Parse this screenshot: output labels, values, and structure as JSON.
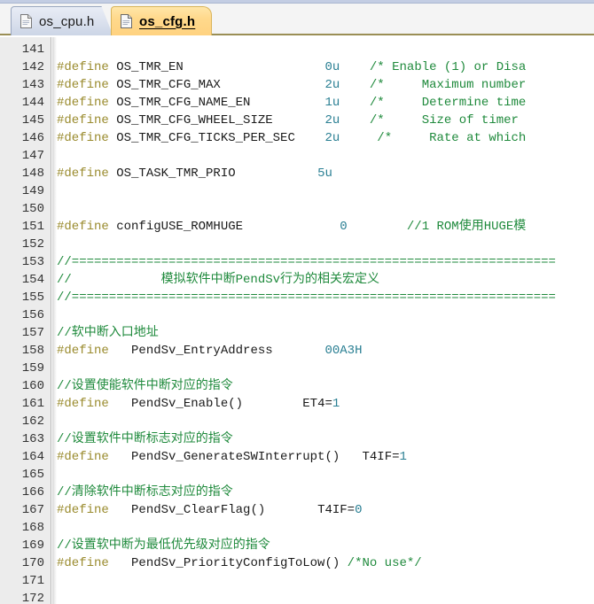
{
  "window": {
    "title": "os_cfg.h",
    "accent_active_tab": "#ffd280",
    "accent_inactive_tab": "#dde3ef",
    "tabbar_bottom_border": "#9a8e55"
  },
  "tabs": [
    {
      "label": "os_cpu.h",
      "icon": "document-icon",
      "active": false
    },
    {
      "label": "os_cfg.h",
      "icon": "document-icon",
      "active": true
    }
  ],
  "editor": {
    "first_line": 141,
    "last_line": 172,
    "colors": {
      "keyword": "#9a8b2e",
      "identifier": "#1a1a1a",
      "number": "#2a7f93",
      "comment": "#1f8a3c",
      "gutter_bg": "#ececec",
      "gutter_text": "#333333",
      "background": "#ffffff"
    },
    "line_numbers": [
      "141",
      "142",
      "143",
      "144",
      "145",
      "146",
      "147",
      "148",
      "149",
      "150",
      "151",
      "152",
      "153",
      "154",
      "155",
      "156",
      "157",
      "158",
      "159",
      "160",
      "161",
      "162",
      "163",
      "164",
      "165",
      "166",
      "167",
      "168",
      "169",
      "170",
      "171",
      "172"
    ],
    "lines": [
      {
        "n": 141,
        "text": "",
        "spans": []
      },
      {
        "n": 142,
        "text": "#define OS_TMR_EN                  0u   /* Enable (1) or Disa",
        "spans": [
          {
            "t": "#define ",
            "c": "kw"
          },
          {
            "t": "OS_TMR_EN",
            "c": "id"
          },
          {
            "t": "                   ",
            "c": "id"
          },
          {
            "t": "0u",
            "c": "num"
          },
          {
            "t": "    ",
            "c": "id"
          },
          {
            "t": "/* Enable (1) or Disa",
            "c": "cmt"
          }
        ]
      },
      {
        "n": 143,
        "text": "#define OS_TMR_CFG_MAX             2u   /*     Maximum number",
        "spans": [
          {
            "t": "#define ",
            "c": "kw"
          },
          {
            "t": "OS_TMR_CFG_MAX",
            "c": "id"
          },
          {
            "t": "              ",
            "c": "id"
          },
          {
            "t": "2u",
            "c": "num"
          },
          {
            "t": "    ",
            "c": "id"
          },
          {
            "t": "/*     Maximum number",
            "c": "cmt"
          }
        ]
      },
      {
        "n": 144,
        "text": "#define OS_TMR_CFG_NAME_EN         1u   /*     Determine time",
        "spans": [
          {
            "t": "#define ",
            "c": "kw"
          },
          {
            "t": "OS_TMR_CFG_NAME_EN",
            "c": "id"
          },
          {
            "t": "          ",
            "c": "id"
          },
          {
            "t": "1u",
            "c": "num"
          },
          {
            "t": "    ",
            "c": "id"
          },
          {
            "t": "/*     Determine time",
            "c": "cmt"
          }
        ]
      },
      {
        "n": 145,
        "text": "#define OS_TMR_CFG_WHEEL_SIZE      2u   /*     Size of timer",
        "spans": [
          {
            "t": "#define ",
            "c": "kw"
          },
          {
            "t": "OS_TMR_CFG_WHEEL_SIZE",
            "c": "id"
          },
          {
            "t": "       ",
            "c": "id"
          },
          {
            "t": "2u",
            "c": "num"
          },
          {
            "t": "    ",
            "c": "id"
          },
          {
            "t": "/*     Size of timer",
            "c": "cmt"
          }
        ]
      },
      {
        "n": 146,
        "text": "#define OS_TMR_CFG_TICKS_PER_SEC   2u    /*     Rate at which",
        "spans": [
          {
            "t": "#define ",
            "c": "kw"
          },
          {
            "t": "OS_TMR_CFG_TICKS_PER_SEC",
            "c": "id"
          },
          {
            "t": "    ",
            "c": "id"
          },
          {
            "t": "2u",
            "c": "num"
          },
          {
            "t": "     ",
            "c": "id"
          },
          {
            "t": "/*     Rate at which",
            "c": "cmt"
          }
        ]
      },
      {
        "n": 147,
        "text": "",
        "spans": []
      },
      {
        "n": 148,
        "text": "#define OS_TASK_TMR_PRIO           5u",
        "spans": [
          {
            "t": "#define ",
            "c": "kw"
          },
          {
            "t": "OS_TASK_TMR_PRIO",
            "c": "id"
          },
          {
            "t": "           ",
            "c": "id"
          },
          {
            "t": "5u",
            "c": "num"
          }
        ]
      },
      {
        "n": 149,
        "text": "",
        "spans": []
      },
      {
        "n": 150,
        "text": "",
        "spans": []
      },
      {
        "n": 151,
        "text": "#define configUSE_ROMHUGE             0        //1 ROM使用HUGE模",
        "spans": [
          {
            "t": "#define ",
            "c": "kw"
          },
          {
            "t": "configUSE_ROMHUGE",
            "c": "id"
          },
          {
            "t": "             ",
            "c": "id"
          },
          {
            "t": "0",
            "c": "num"
          },
          {
            "t": "        ",
            "c": "id"
          },
          {
            "t": "//1 ROM使用HUGE模",
            "c": "cmt"
          }
        ]
      },
      {
        "n": 152,
        "text": "",
        "spans": []
      },
      {
        "n": 153,
        "text": "//=================================================================",
        "spans": [
          {
            "t": "//=================================================================",
            "c": "cmt"
          }
        ]
      },
      {
        "n": 154,
        "text": "//            模拟软件中断PendSv行为的相关宏定义",
        "spans": [
          {
            "t": "//            模拟软件中断PendSv行为的相关宏定义",
            "c": "cmt"
          }
        ]
      },
      {
        "n": 155,
        "text": "//=================================================================",
        "spans": [
          {
            "t": "//=================================================================",
            "c": "cmt"
          }
        ]
      },
      {
        "n": 156,
        "text": "",
        "spans": []
      },
      {
        "n": 157,
        "text": "//软中断入口地址",
        "spans": [
          {
            "t": "//软中断入口地址",
            "c": "cmt"
          }
        ]
      },
      {
        "n": 158,
        "text": "#define   PendSv_EntryAddress       00A3H",
        "spans": [
          {
            "t": "#define   ",
            "c": "kw"
          },
          {
            "t": "PendSv_EntryAddress",
            "c": "id"
          },
          {
            "t": "       ",
            "c": "id"
          },
          {
            "t": "00A3H",
            "c": "num"
          }
        ]
      },
      {
        "n": 159,
        "text": "",
        "spans": []
      },
      {
        "n": 160,
        "text": "//设置使能软件中断对应的指令",
        "spans": [
          {
            "t": "//设置使能软件中断对应的指令",
            "c": "cmt"
          }
        ]
      },
      {
        "n": 161,
        "text": "#define   PendSv_Enable()        ET4=1",
        "spans": [
          {
            "t": "#define   ",
            "c": "kw"
          },
          {
            "t": "PendSv_Enable()",
            "c": "id"
          },
          {
            "t": "        ",
            "c": "id"
          },
          {
            "t": "ET4=",
            "c": "id"
          },
          {
            "t": "1",
            "c": "num"
          }
        ]
      },
      {
        "n": 162,
        "text": "",
        "spans": []
      },
      {
        "n": 163,
        "text": "//设置软件中断标志对应的指令",
        "spans": [
          {
            "t": "//设置软件中断标志对应的指令",
            "c": "cmt"
          }
        ]
      },
      {
        "n": 164,
        "text": "#define   PendSv_GenerateSWInterrupt()   T4IF=1",
        "spans": [
          {
            "t": "#define   ",
            "c": "kw"
          },
          {
            "t": "PendSv_GenerateSWInterrupt()",
            "c": "id"
          },
          {
            "t": "   ",
            "c": "id"
          },
          {
            "t": "T4IF=",
            "c": "id"
          },
          {
            "t": "1",
            "c": "num"
          }
        ]
      },
      {
        "n": 165,
        "text": "",
        "spans": []
      },
      {
        "n": 166,
        "text": "//清除软件中断标志对应的指令",
        "spans": [
          {
            "t": "//清除软件中断标志对应的指令",
            "c": "cmt"
          }
        ]
      },
      {
        "n": 167,
        "text": "#define   PendSv_ClearFlag()       T4IF=0",
        "spans": [
          {
            "t": "#define   ",
            "c": "kw"
          },
          {
            "t": "PendSv_ClearFlag()",
            "c": "id"
          },
          {
            "t": "       ",
            "c": "id"
          },
          {
            "t": "T4IF=",
            "c": "id"
          },
          {
            "t": "0",
            "c": "num"
          }
        ]
      },
      {
        "n": 168,
        "text": "",
        "spans": []
      },
      {
        "n": 169,
        "text": "//设置软中断为最低优先级对应的指令",
        "spans": [
          {
            "t": "//设置软中断为最低优先级对应的指令",
            "c": "cmt"
          }
        ]
      },
      {
        "n": 170,
        "text": "#define   PendSv_PriorityConfigToLow() /*No use*/",
        "spans": [
          {
            "t": "#define   ",
            "c": "kw"
          },
          {
            "t": "PendSv_PriorityConfigToLow()",
            "c": "id"
          },
          {
            "t": " ",
            "c": "id"
          },
          {
            "t": "/*No use*/",
            "c": "cmt"
          }
        ]
      },
      {
        "n": 171,
        "text": "",
        "spans": []
      },
      {
        "n": 172,
        "text": "",
        "spans": []
      }
    ]
  }
}
